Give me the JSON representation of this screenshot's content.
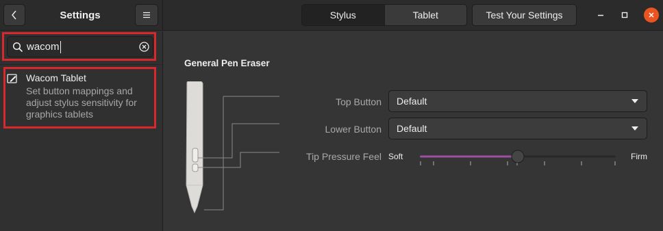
{
  "header": {
    "title": "Settings",
    "tabs": [
      {
        "label": "Stylus",
        "active": true
      },
      {
        "label": "Tablet",
        "active": false
      }
    ],
    "test_button": "Test Your Settings"
  },
  "sidebar": {
    "search": {
      "value": "wacom"
    },
    "results": [
      {
        "icon": "tablet-edit-icon",
        "title": "Wacom Tablet",
        "description": "Set button mappings and adjust stylus sensitivity for graphics tablets"
      }
    ]
  },
  "main": {
    "heading": "General Pen Eraser",
    "top_button": {
      "label": "Top Button",
      "value": "Default"
    },
    "lower_button": {
      "label": "Lower Button",
      "value": "Default"
    },
    "tip_pressure": {
      "label": "Tip Pressure Feel",
      "min_label": "Soft",
      "max_label": "Firm",
      "level": 0.5
    }
  },
  "colors": {
    "accent": "#e95420",
    "highlight": "#d9272e",
    "slider_fill": "#9b4fa0"
  }
}
